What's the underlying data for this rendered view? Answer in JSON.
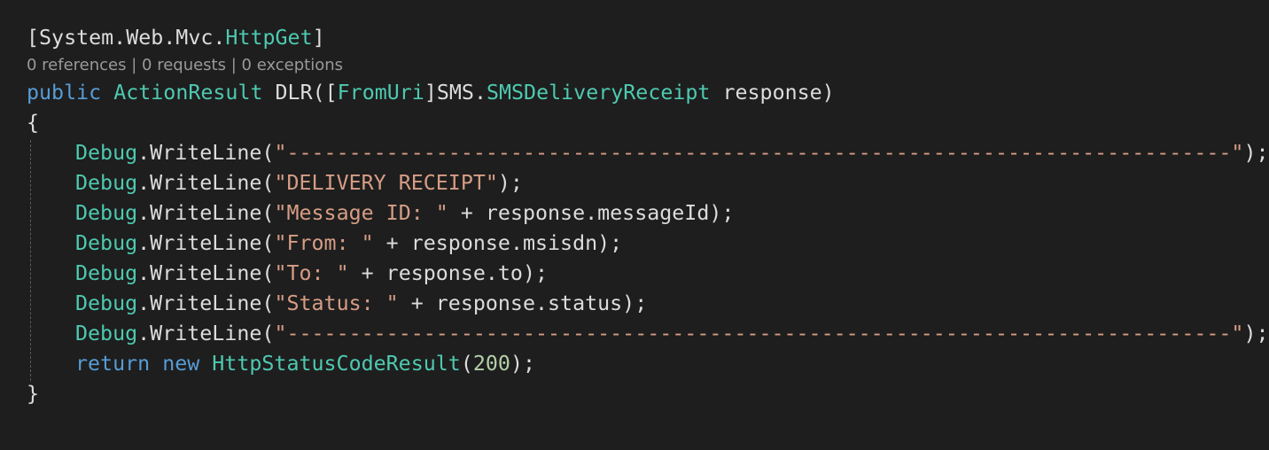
{
  "colors": {
    "background": "#1e1e1e",
    "plain": "#dcdcdc",
    "keyword": "#569cd6",
    "type": "#4ec9b0",
    "string": "#d69d85",
    "number": "#b5cea8",
    "codelens": "#999999"
  },
  "codelens": {
    "references": "0 references",
    "requests": "0 requests",
    "exceptions": "0 exceptions",
    "separator": " | "
  },
  "lines": [
    [
      {
        "t": "[System.Web.Mvc.",
        "c": "plain"
      },
      {
        "t": "HttpGet",
        "c": "type"
      },
      {
        "t": "]",
        "c": "plain"
      }
    ],
    [
      {
        "t": "public",
        "c": "keyword"
      },
      {
        "t": " ",
        "c": "plain"
      },
      {
        "t": "ActionResult",
        "c": "type"
      },
      {
        "t": " DLR([",
        "c": "plain"
      },
      {
        "t": "FromUri",
        "c": "type"
      },
      {
        "t": "]SMS.",
        "c": "plain"
      },
      {
        "t": "SMSDeliveryReceipt",
        "c": "type"
      },
      {
        "t": " response)",
        "c": "plain"
      }
    ],
    [
      {
        "t": "{",
        "c": "plain"
      }
    ],
    [
      {
        "t": "Debug",
        "c": "type"
      },
      {
        "t": ".WriteLine(",
        "c": "plain"
      },
      {
        "t": "\"----------------------------------------------------------------------------\"",
        "c": "string"
      },
      {
        "t": ");",
        "c": "plain"
      }
    ],
    [
      {
        "t": "Debug",
        "c": "type"
      },
      {
        "t": ".WriteLine(",
        "c": "plain"
      },
      {
        "t": "\"DELIVERY RECEIPT\"",
        "c": "string"
      },
      {
        "t": ");",
        "c": "plain"
      }
    ],
    [
      {
        "t": "Debug",
        "c": "type"
      },
      {
        "t": ".WriteLine(",
        "c": "plain"
      },
      {
        "t": "\"Message ID: \"",
        "c": "string"
      },
      {
        "t": " + response.messageId);",
        "c": "plain"
      }
    ],
    [
      {
        "t": "Debug",
        "c": "type"
      },
      {
        "t": ".WriteLine(",
        "c": "plain"
      },
      {
        "t": "\"From: \"",
        "c": "string"
      },
      {
        "t": " + response.msisdn);",
        "c": "plain"
      }
    ],
    [
      {
        "t": "Debug",
        "c": "type"
      },
      {
        "t": ".WriteLine(",
        "c": "plain"
      },
      {
        "t": "\"To: \"",
        "c": "string"
      },
      {
        "t": " + response.to);",
        "c": "plain"
      }
    ],
    [
      {
        "t": "Debug",
        "c": "type"
      },
      {
        "t": ".WriteLine(",
        "c": "plain"
      },
      {
        "t": "\"Status: \"",
        "c": "string"
      },
      {
        "t": " + response.status);",
        "c": "plain"
      }
    ],
    [
      {
        "t": "Debug",
        "c": "type"
      },
      {
        "t": ".WriteLine(",
        "c": "plain"
      },
      {
        "t": "\"----------------------------------------------------------------------------\"",
        "c": "string"
      },
      {
        "t": ");",
        "c": "plain"
      }
    ],
    [
      {
        "t": "return",
        "c": "keyword"
      },
      {
        "t": " ",
        "c": "plain"
      },
      {
        "t": "new",
        "c": "keyword"
      },
      {
        "t": " ",
        "c": "plain"
      },
      {
        "t": "HttpStatusCodeResult",
        "c": "type"
      },
      {
        "t": "(",
        "c": "plain"
      },
      {
        "t": "200",
        "c": "number"
      },
      {
        "t": ");",
        "c": "plain"
      }
    ],
    [
      {
        "t": "}",
        "c": "plain"
      }
    ]
  ]
}
